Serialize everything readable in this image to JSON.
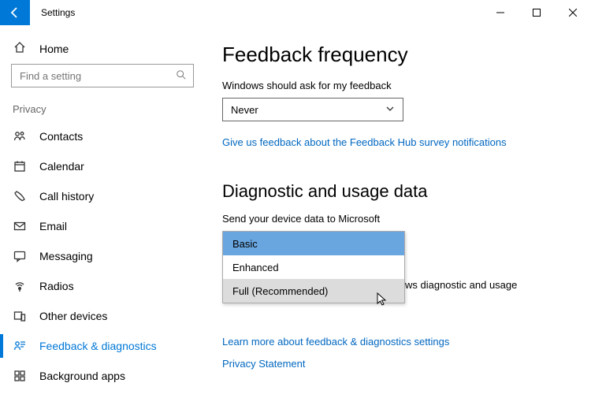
{
  "titlebar": {
    "app_name": "Settings"
  },
  "sidebar": {
    "home_label": "Home",
    "search_placeholder": "Find a setting",
    "category": "Privacy",
    "items": [
      {
        "label": "Contacts"
      },
      {
        "label": "Calendar"
      },
      {
        "label": "Call history"
      },
      {
        "label": "Email"
      },
      {
        "label": "Messaging"
      },
      {
        "label": "Radios"
      },
      {
        "label": "Other devices"
      },
      {
        "label": "Feedback & diagnostics"
      },
      {
        "label": "Background apps"
      }
    ]
  },
  "content": {
    "feedback": {
      "heading": "Feedback frequency",
      "prompt": "Windows should ask for my feedback",
      "value": "Never",
      "link": "Give us feedback about the Feedback Hub survey notifications"
    },
    "diag": {
      "heading": "Diagnostic and usage data",
      "prompt": "Send your device data to Microsoft",
      "options": [
        "Basic",
        "Enhanced",
        "Full (Recommended)"
      ],
      "behind_text": "ws diagnostic and usage",
      "link1": "Learn more about feedback & diagnostics settings",
      "link2": "Privacy Statement"
    }
  }
}
